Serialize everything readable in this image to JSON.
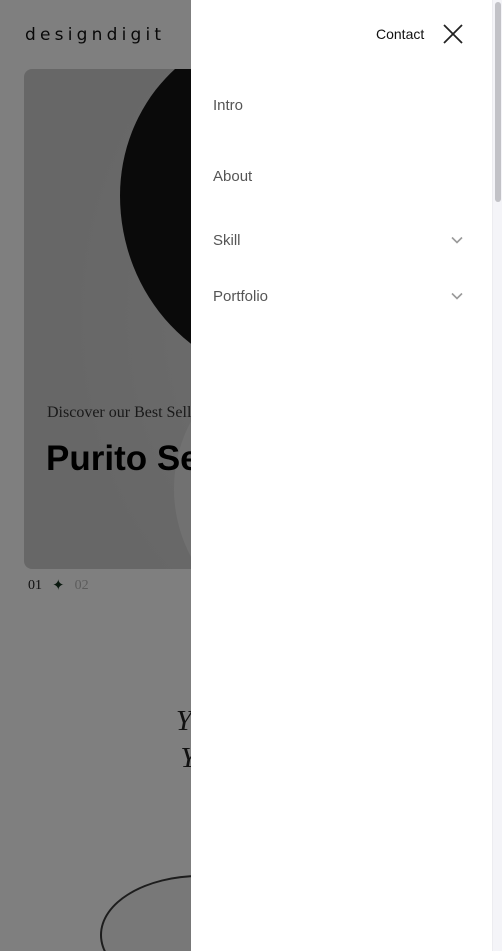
{
  "site": {
    "logo": "designdigit"
  },
  "hero": {
    "subtitle": "Discover our Best Seller",
    "title": "Purito Seoul",
    "pager": {
      "current": "01",
      "next": "02"
    }
  },
  "section": {
    "title_line1": "YOUR SKIN",
    "title_line2": "YOUR WAY"
  },
  "drawer": {
    "contact_label": "Contact",
    "items": [
      {
        "label": "Intro",
        "has_submenu": false
      },
      {
        "label": "About",
        "has_submenu": false
      },
      {
        "label": "Skill",
        "has_submenu": true
      },
      {
        "label": "Portfolio",
        "has_submenu": true
      }
    ]
  },
  "colors": {
    "overlay": "rgba(0,0,0,0.5)",
    "drawer_bg": "#ffffff",
    "star": "#14321f"
  },
  "icons": [
    "close-icon",
    "chevron-down-icon",
    "star-separator-icon"
  ]
}
